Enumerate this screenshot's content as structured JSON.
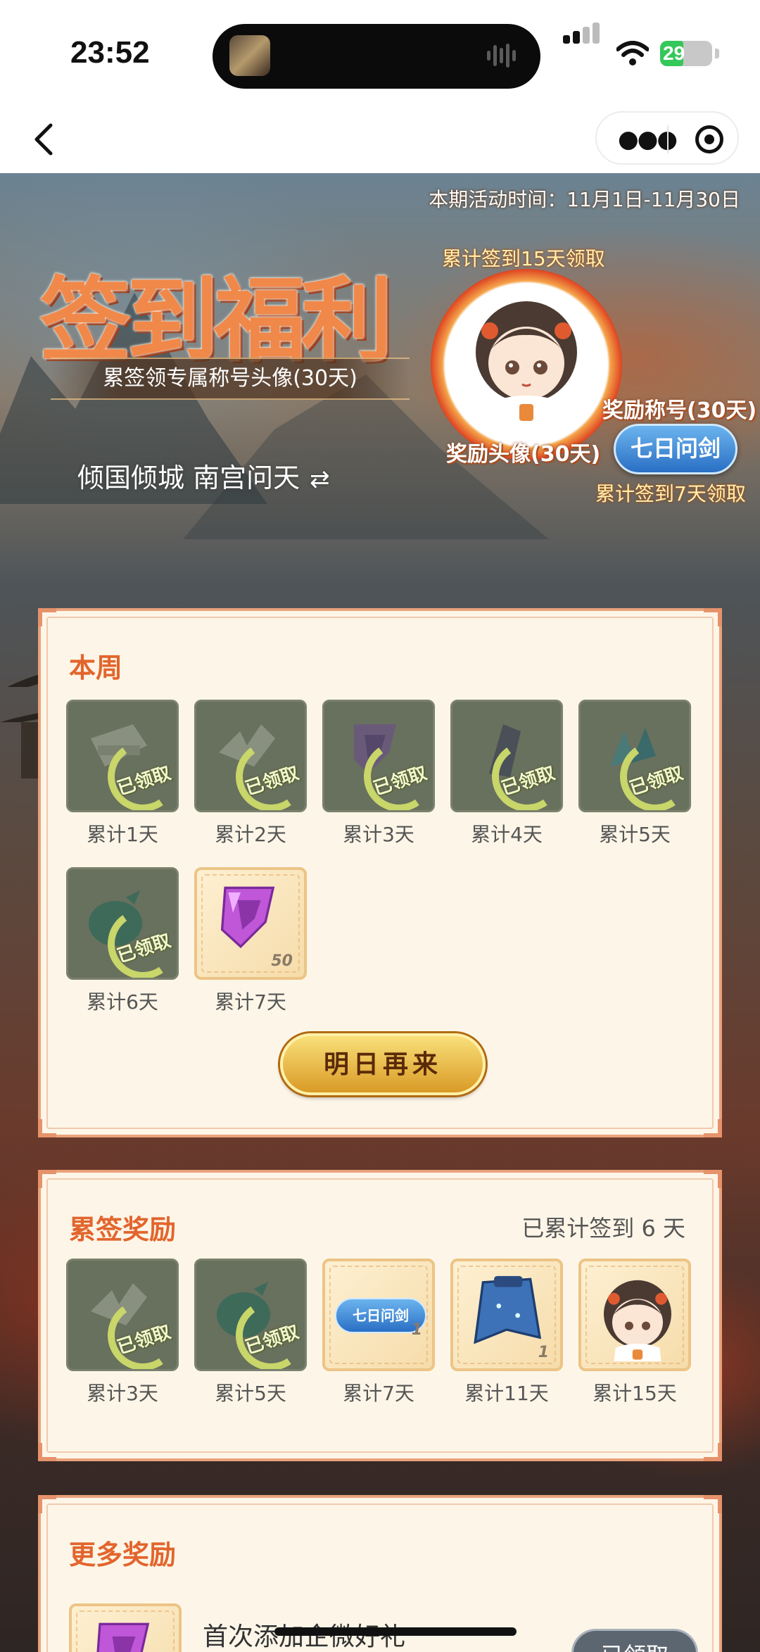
{
  "status_bar": {
    "time": "23:52",
    "battery": "29",
    "battery_level": 0.29
  },
  "nav": {
    "back_icon": "chevron-left-icon",
    "more_icon": "more-dots-icon",
    "close_icon": "target-icon"
  },
  "hero": {
    "period": "本期活动时间：11月1日-11月30日",
    "title": "签到福利",
    "subtitle": "累签领专属称号头像(30天)",
    "account": "倾国倾城 南宫问天",
    "swap_icon": "swap-arrows-icon",
    "avatar_caption": "累计签到15天领取",
    "avatar_label": "奖励头像(30天)",
    "title_label": "奖励称号(30天)",
    "title_badge": "七日问剑",
    "title_caption": "累计签到7天领取"
  },
  "week": {
    "title": "本周",
    "stamp": "已领取",
    "items": [
      {
        "label": "累计1天",
        "claimed": true,
        "icon": "scroll-item-icon"
      },
      {
        "label": "累计2天",
        "claimed": true,
        "icon": "broken-blade-icon"
      },
      {
        "label": "累计3天",
        "claimed": true,
        "icon": "purple-gem-icon"
      },
      {
        "label": "累计4天",
        "claimed": true,
        "icon": "dark-crystal-icon"
      },
      {
        "label": "累计5天",
        "claimed": true,
        "icon": "jade-shard-icon"
      },
      {
        "label": "累计6天",
        "claimed": true,
        "icon": "green-pouch-icon"
      },
      {
        "label": "累计7天",
        "claimed": false,
        "icon": "purple-gem-icon",
        "qty": "50"
      }
    ],
    "button": "明日再来"
  },
  "cumulative": {
    "title": "累签奖励",
    "summary": "已累计签到 6 天",
    "stamp": "已领取",
    "items": [
      {
        "label": "累计3天",
        "claimed": true,
        "icon": "broken-blade-icon"
      },
      {
        "label": "累计5天",
        "claimed": true,
        "icon": "green-pouch-icon"
      },
      {
        "label": "累计7天",
        "claimed": false,
        "icon": "title-badge-icon",
        "badge": "七日问剑",
        "qty": "1"
      },
      {
        "label": "累计11天",
        "claimed": false,
        "icon": "blue-cape-icon",
        "qty": "1"
      },
      {
        "label": "累计15天",
        "claimed": false,
        "icon": "avatar-girl-icon"
      }
    ]
  },
  "more": {
    "title": "更多奖励",
    "item_text": "首次添加企微好礼",
    "button": "已领取"
  },
  "colors": {
    "accent": "#e2652d",
    "card_bg": "#fdf6e8",
    "card_border": "#eaa27b",
    "claimed_tile": "#68705e"
  }
}
